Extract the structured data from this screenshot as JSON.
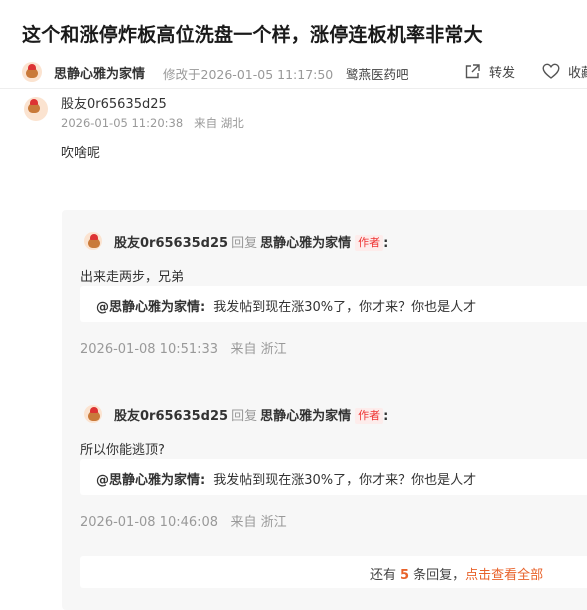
{
  "post": {
    "title": "这个和涨停炸板高位洗盘一个样，涨停连板机率非常大",
    "author": "思静心雅为家情",
    "modified": "修改于2026-01-05 11:17:50",
    "bar": "鹭燕医药吧",
    "share_label": "转发",
    "fav_label": "收藏"
  },
  "comment": {
    "name": "股友0r65635d25",
    "time": "2026-01-05 11:20:38",
    "location": "来自 湖北",
    "text": "吹啥呢"
  },
  "replies": [
    {
      "from": "股友0r65635d25",
      "reply_word": "回复",
      "to": "思静心雅为家情",
      "tag": "作者",
      "text": "出来走两步，兄弟",
      "quote_author": "@思静心雅为家情:",
      "quote_text": "我发帖到现在涨30%了，你才来？你也是人才",
      "time": "2026-01-08 10:51:33",
      "location": "来自 浙江"
    },
    {
      "from": "股友0r65635d25",
      "reply_word": "回复",
      "to": "思静心雅为家情",
      "tag": "作者",
      "text": "所以你能逃顶?",
      "quote_author": "@思静心雅为家情:",
      "quote_text": "我发帖到现在涨30%了，你才来？你也是人才",
      "time": "2026-01-08 10:46:08",
      "location": "来自 浙江"
    }
  ],
  "more": {
    "prefix": "还有",
    "count": "5",
    "suffix": "条回复，",
    "link": "点击查看全部"
  },
  "colors": {
    "accent": "#e8622a",
    "tag_red": "#e33",
    "panel": "#f7f7f7"
  },
  "icons": [
    "avatar-icon",
    "share-icon",
    "heart-icon"
  ]
}
